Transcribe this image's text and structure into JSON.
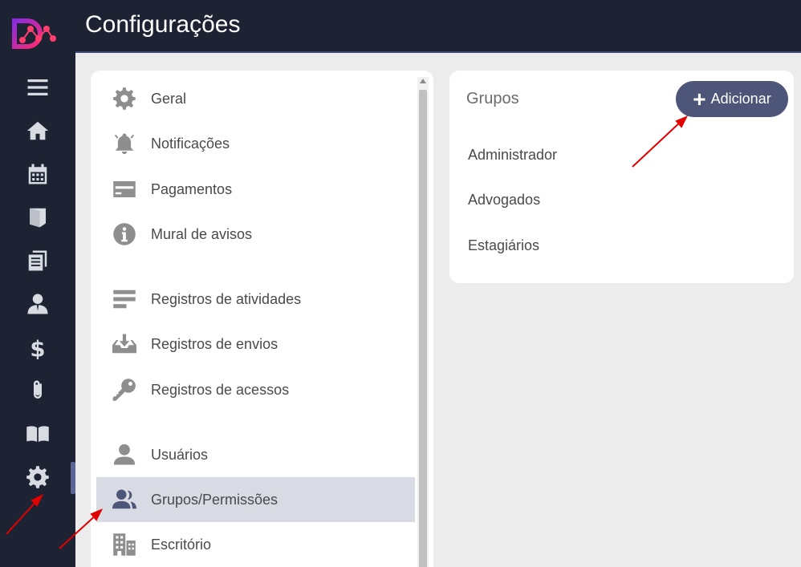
{
  "header": {
    "title": "Configurações"
  },
  "rail": {
    "items": [
      {
        "icon": "menu-icon"
      },
      {
        "icon": "home-icon"
      },
      {
        "icon": "calendar-icon"
      },
      {
        "icon": "folder-door-icon"
      },
      {
        "icon": "documents-icon"
      },
      {
        "icon": "user-icon"
      },
      {
        "icon": "dollar-icon"
      },
      {
        "icon": "paperclip-icon"
      },
      {
        "icon": "book-icon"
      },
      {
        "icon": "gear-icon",
        "active": true
      }
    ]
  },
  "menu": {
    "items": [
      {
        "label": "Geral",
        "icon": "gear-icon"
      },
      {
        "label": "Notificações",
        "icon": "bell-icon"
      },
      {
        "label": "Pagamentos",
        "icon": "credit-card-icon"
      },
      {
        "label": "Mural de avisos",
        "icon": "info-icon"
      },
      {
        "label": "Registros de atividades",
        "icon": "list-icon"
      },
      {
        "label": "Registros de envios",
        "icon": "inbox-download-icon"
      },
      {
        "label": "Registros de acessos",
        "icon": "key-icon"
      },
      {
        "label": "Usuários",
        "icon": "user-icon"
      },
      {
        "label": "Grupos/Permissões",
        "icon": "users-icon",
        "selected": true
      },
      {
        "label": "Escritório",
        "icon": "building-icon"
      }
    ]
  },
  "groups": {
    "title": "Grupos",
    "add_label": "Adicionar",
    "list": [
      "Administrador",
      "Advogados",
      "Estagiários"
    ]
  },
  "colors": {
    "rail_bg": "#1e2333",
    "accent": "#4d5578",
    "selected_row": "#d9dbe4",
    "annotation_arrow": "#e00000"
  }
}
